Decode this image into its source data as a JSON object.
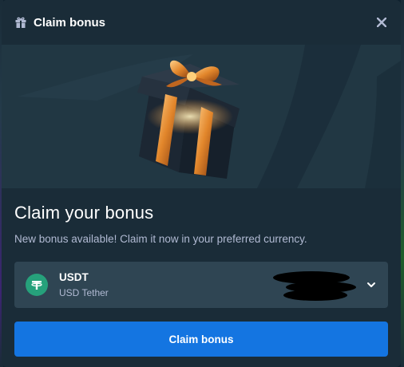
{
  "header": {
    "title": "Claim bonus",
    "icon": "gift-icon",
    "close_icon": "close-icon"
  },
  "banner": {
    "image": "gift-box-illustration"
  },
  "content": {
    "title": "Claim your bonus",
    "description": "New bonus available! Claim it now in your preferred currency."
  },
  "currency": {
    "code": "USDT",
    "name": "USD Tether",
    "icon": "tether-icon",
    "icon_color": "#26a17b"
  },
  "actions": {
    "claim_label": "Claim bonus"
  },
  "colors": {
    "modal_bg": "#1a2c38",
    "banner_bg": "#213743",
    "select_bg": "#2f4553",
    "accent": "#1475e1",
    "muted_text": "#b1bad3"
  }
}
